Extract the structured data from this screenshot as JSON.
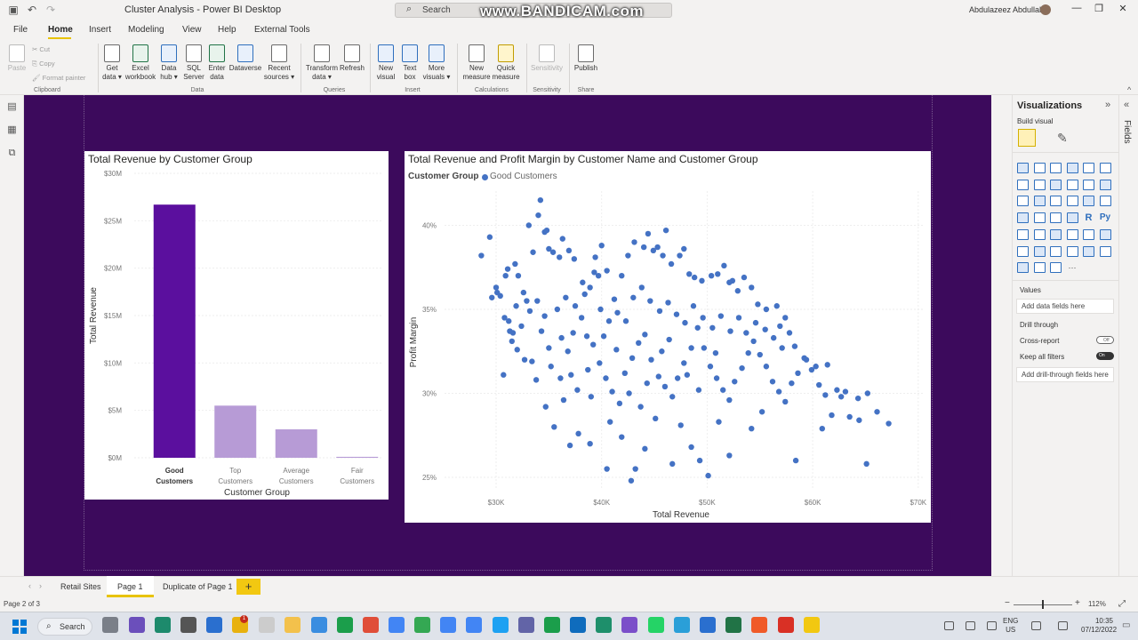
{
  "window": {
    "title": "Cluster Analysis - Power BI Desktop",
    "search_placeholder": "Search",
    "watermark": "www.BANDICAM.com",
    "user": "Abdulazeez Abdullah"
  },
  "menu": [
    "File",
    "Home",
    "Insert",
    "Modeling",
    "View",
    "Help",
    "External Tools"
  ],
  "ribbon": {
    "clipboard": {
      "paste": "Paste",
      "cut": "Cut",
      "copy": "Copy",
      "format_painter": "Format painter",
      "group": "Clipboard"
    },
    "data": {
      "get_data_1": "Get",
      "get_data_2": "data ▾",
      "excel_1": "Excel",
      "excel_2": "workbook",
      "hub_1": "Data",
      "hub_2": "hub ▾",
      "sql_1": "SQL",
      "sql_2": "Server",
      "enter_1": "Enter",
      "enter_2": "data",
      "dataverse": "Dataverse",
      "recent_1": "Recent",
      "recent_2": "sources ▾",
      "group": "Data"
    },
    "queries": {
      "transform_1": "Transform",
      "transform_2": "data ▾",
      "refresh": "Refresh",
      "group": "Queries"
    },
    "insert": {
      "visual_1": "New",
      "visual_2": "visual",
      "text_1": "Text",
      "text_2": "box",
      "more_1": "More",
      "more_2": "visuals ▾",
      "group": "Insert"
    },
    "calculations": {
      "measure_1": "New",
      "measure_2": "measure",
      "quick_1": "Quick",
      "quick_2": "measure",
      "group": "Calculations"
    },
    "sensitivity": {
      "label": "Sensitivity",
      "group": "Sensitivity"
    },
    "share": {
      "publish": "Publish",
      "group": "Share"
    }
  },
  "visual1": {
    "title": "Total Revenue by Customer Group",
    "y_label": "Total Revenue",
    "x_label": "Customer Group",
    "y_ticks": [
      "$0M",
      "$5M",
      "$10M",
      "$15M",
      "$20M",
      "$25M",
      "$30M"
    ],
    "category_lines": [
      [
        "Good",
        "Customers"
      ],
      [
        "Top",
        "Customers"
      ],
      [
        "Average",
        "Customers"
      ],
      [
        "Fair",
        "Customers"
      ]
    ],
    "colors": {
      "good": "#5b0f9e",
      "other": "#b79bd6"
    }
  },
  "visual2": {
    "title": "Total Revenue and Profit Margin by Customer Name and Customer Group",
    "legend_title": "Customer Group",
    "legend_item": "Good Customers",
    "x_label": "Total Revenue",
    "y_label": "Profit Margin",
    "x_ticks": [
      "$30K",
      "$40K",
      "$50K",
      "$60K",
      "$70K"
    ],
    "y_ticks": [
      "25%",
      "30%",
      "35%",
      "40%"
    ],
    "point_color": "#4472c4"
  },
  "chart_data": [
    {
      "type": "bar",
      "title": "Total Revenue by Customer Group",
      "xlabel": "Customer Group",
      "ylabel": "Total Revenue",
      "categories": [
        "Good Customers",
        "Top Customers",
        "Average Customers",
        "Fair Customers"
      ],
      "values": [
        26.7,
        5.5,
        3.0,
        0.1
      ],
      "unit": "$M",
      "ylim": [
        0,
        30
      ],
      "grid": true
    },
    {
      "type": "scatter",
      "title": "Total Revenue and Profit Margin by Customer Name and Customer Group",
      "xlabel": "Total Revenue",
      "ylabel": "Profit Margin",
      "xlim": [
        26,
        72
      ],
      "ylim": [
        24,
        42
      ],
      "x_unit": "$K",
      "y_unit": "%",
      "legend": "top-left",
      "series": [
        {
          "name": "Good Customers",
          "points": [
            [
              28.6,
              38.2
            ],
            [
              29.4,
              39.3
            ],
            [
              29.6,
              35.7
            ],
            [
              30.1,
              36.0
            ],
            [
              30.4,
              35.8
            ],
            [
              30.0,
              36.3
            ],
            [
              30.9,
              37.0
            ],
            [
              31.1,
              37.4
            ],
            [
              30.8,
              34.5
            ],
            [
              31.2,
              34.3
            ],
            [
              31.6,
              33.6
            ],
            [
              31.8,
              37.7
            ],
            [
              32.1,
              37.0
            ],
            [
              32.6,
              36.0
            ],
            [
              32.9,
              35.5
            ],
            [
              33.1,
              40.0
            ],
            [
              33.5,
              38.4
            ],
            [
              34.0,
              40.6
            ],
            [
              34.2,
              41.5
            ],
            [
              34.6,
              39.6
            ],
            [
              34.8,
              39.7
            ],
            [
              35.0,
              38.6
            ],
            [
              35.4,
              38.4
            ],
            [
              36.0,
              38.1
            ],
            [
              36.3,
              39.2
            ],
            [
              36.9,
              38.5
            ],
            [
              37.4,
              38.0
            ],
            [
              38.2,
              36.6
            ],
            [
              38.9,
              36.3
            ],
            [
              39.3,
              37.2
            ],
            [
              39.7,
              37.0
            ],
            [
              39.4,
              38.1
            ],
            [
              40.0,
              38.8
            ],
            [
              40.5,
              37.3
            ],
            [
              41.2,
              35.6
            ],
            [
              41.9,
              37.0
            ],
            [
              42.5,
              38.2
            ],
            [
              43.1,
              39.0
            ],
            [
              44.0,
              38.7
            ],
            [
              44.4,
              39.5
            ],
            [
              44.9,
              38.5
            ],
            [
              45.3,
              38.7
            ],
            [
              45.8,
              38.2
            ],
            [
              46.1,
              39.7
            ],
            [
              46.6,
              37.7
            ],
            [
              47.4,
              38.2
            ],
            [
              47.8,
              38.6
            ],
            [
              48.3,
              37.1
            ],
            [
              48.8,
              36.9
            ],
            [
              49.5,
              36.7
            ],
            [
              50.4,
              37.0
            ],
            [
              51.0,
              37.1
            ],
            [
              51.6,
              37.6
            ],
            [
              52.1,
              36.6
            ],
            [
              52.4,
              36.7
            ],
            [
              52.9,
              36.1
            ],
            [
              53.5,
              36.9
            ],
            [
              54.2,
              36.3
            ],
            [
              54.8,
              35.3
            ],
            [
              55.6,
              35.0
            ],
            [
              56.6,
              35.2
            ],
            [
              56.9,
              34.0
            ],
            [
              57.4,
              34.5
            ],
            [
              58.3,
              32.8
            ],
            [
              59.4,
              32.0
            ],
            [
              60.3,
              31.6
            ],
            [
              61.4,
              31.7
            ],
            [
              62.3,
              30.2
            ],
            [
              63.1,
              30.1
            ],
            [
              64.3,
              29.7
            ],
            [
              65.2,
              30.0
            ],
            [
              66.1,
              28.9
            ],
            [
              67.2,
              28.2
            ],
            [
              65.1,
              25.8
            ],
            [
              58.4,
              26.0
            ],
            [
              52.1,
              26.3
            ],
            [
              50.1,
              25.1
            ],
            [
              49.3,
              26.0
            ],
            [
              48.5,
              26.8
            ],
            [
              46.7,
              25.8
            ],
            [
              44.1,
              26.7
            ],
            [
              43.2,
              25.5
            ],
            [
              42.8,
              24.8
            ],
            [
              41.9,
              27.4
            ],
            [
              40.5,
              25.5
            ],
            [
              38.9,
              27.0
            ],
            [
              37.8,
              27.6
            ],
            [
              37.0,
              26.9
            ],
            [
              36.4,
              29.6
            ],
            [
              35.5,
              28.0
            ],
            [
              34.7,
              29.2
            ],
            [
              33.8,
              30.8
            ],
            [
              33.4,
              31.9
            ],
            [
              32.7,
              32.0
            ],
            [
              32.0,
              32.6
            ],
            [
              31.5,
              33.1
            ],
            [
              31.3,
              33.7
            ],
            [
              30.7,
              31.1
            ],
            [
              35.2,
              31.6
            ],
            [
              36.1,
              30.9
            ],
            [
              36.8,
              32.5
            ],
            [
              37.3,
              33.6
            ],
            [
              38.1,
              34.5
            ],
            [
              38.6,
              33.4
            ],
            [
              39.2,
              32.9
            ],
            [
              39.8,
              31.8
            ],
            [
              40.4,
              30.9
            ],
            [
              41.0,
              30.1
            ],
            [
              41.7,
              29.4
            ],
            [
              42.2,
              31.2
            ],
            [
              42.9,
              32.1
            ],
            [
              43.5,
              33.0
            ],
            [
              44.1,
              33.5
            ],
            [
              44.7,
              32.0
            ],
            [
              45.4,
              31.0
            ],
            [
              46.0,
              30.4
            ],
            [
              46.7,
              29.8
            ],
            [
              47.2,
              30.9
            ],
            [
              47.8,
              31.8
            ],
            [
              48.5,
              32.7
            ],
            [
              49.1,
              33.9
            ],
            [
              49.7,
              32.7
            ],
            [
              50.3,
              31.6
            ],
            [
              50.9,
              30.9
            ],
            [
              51.5,
              30.2
            ],
            [
              52.1,
              29.6
            ],
            [
              52.6,
              30.7
            ],
            [
              53.3,
              31.5
            ],
            [
              53.9,
              32.4
            ],
            [
              54.4,
              33.1
            ],
            [
              55.0,
              32.3
            ],
            [
              55.6,
              31.6
            ],
            [
              56.2,
              30.7
            ],
            [
              56.8,
              30.1
            ],
            [
              57.4,
              29.5
            ],
            [
              58.0,
              30.6
            ],
            [
              58.6,
              31.2
            ],
            [
              59.2,
              32.1
            ],
            [
              59.9,
              31.4
            ],
            [
              60.6,
              30.5
            ],
            [
              61.2,
              29.9
            ],
            [
              61.8,
              28.7
            ],
            [
              62.7,
              29.8
            ],
            [
              63.5,
              28.6
            ],
            [
              64.4,
              28.4
            ],
            [
              60.9,
              27.9
            ],
            [
              55.2,
              28.9
            ],
            [
              54.2,
              27.9
            ],
            [
              51.1,
              28.3
            ],
            [
              47.5,
              28.1
            ],
            [
              45.1,
              28.5
            ],
            [
              43.7,
              29.2
            ],
            [
              40.8,
              28.3
            ],
            [
              39.0,
              29.8
            ],
            [
              37.7,
              30.2
            ],
            [
              34.3,
              33.7
            ],
            [
              33.9,
              35.5
            ],
            [
              35.8,
              35.0
            ],
            [
              36.6,
              35.7
            ],
            [
              37.5,
              35.2
            ],
            [
              38.4,
              35.9
            ],
            [
              39.9,
              35.0
            ],
            [
              40.7,
              34.3
            ],
            [
              41.5,
              34.8
            ],
            [
              42.3,
              34.3
            ],
            [
              43.0,
              35.7
            ],
            [
              43.8,
              36.3
            ],
            [
              44.6,
              35.5
            ],
            [
              45.5,
              34.9
            ],
            [
              46.3,
              35.4
            ],
            [
              47.1,
              34.7
            ],
            [
              47.9,
              34.2
            ],
            [
              48.7,
              35.2
            ],
            [
              49.6,
              34.5
            ],
            [
              50.5,
              33.9
            ],
            [
              51.3,
              34.6
            ],
            [
              52.2,
              33.7
            ],
            [
              53.0,
              34.5
            ],
            [
              53.7,
              33.6
            ],
            [
              54.6,
              34.2
            ],
            [
              55.5,
              33.8
            ],
            [
              56.3,
              33.3
            ],
            [
              57.1,
              32.7
            ],
            [
              57.8,
              33.6
            ],
            [
              45.7,
              32.5
            ],
            [
              46.4,
              33.2
            ],
            [
              48.1,
              31.1
            ],
            [
              49.2,
              30.2
            ],
            [
              50.8,
              32.4
            ],
            [
              44.3,
              30.6
            ],
            [
              42.6,
              30.0
            ],
            [
              41.4,
              32.6
            ],
            [
              40.2,
              33.4
            ],
            [
              38.7,
              31.4
            ],
            [
              37.1,
              31.1
            ],
            [
              36.2,
              33.3
            ],
            [
              35.0,
              32.7
            ],
            [
              34.6,
              34.6
            ],
            [
              33.2,
              34.9
            ],
            [
              32.4,
              34.0
            ],
            [
              31.9,
              35.2
            ]
          ]
        }
      ]
    }
  ],
  "viz_pane": {
    "title": "Visualizations",
    "build": "Build visual",
    "fields_tab": "Fields",
    "values": "Values",
    "values_placeholder": "Add data fields here",
    "drill": "Drill through",
    "cross_report": "Cross-report",
    "cross_state": "Off",
    "keep_filters": "Keep all filters",
    "keep_state": "On",
    "drill_placeholder": "Add drill-through fields here",
    "icon_glyph_r": "R",
    "icon_glyph_py": "Py",
    "more": "···"
  },
  "tabs": [
    "Retail Sites",
    "Page 1",
    "Duplicate of Page 1"
  ],
  "add_tab": "+",
  "status": {
    "page": "Page 2 of 3",
    "zoom": "112%"
  },
  "taskbar": {
    "search": "Search",
    "lang1": "ENG",
    "lang2": "US",
    "time": "10:35",
    "date": "07/12/2022",
    "badge": "1"
  }
}
